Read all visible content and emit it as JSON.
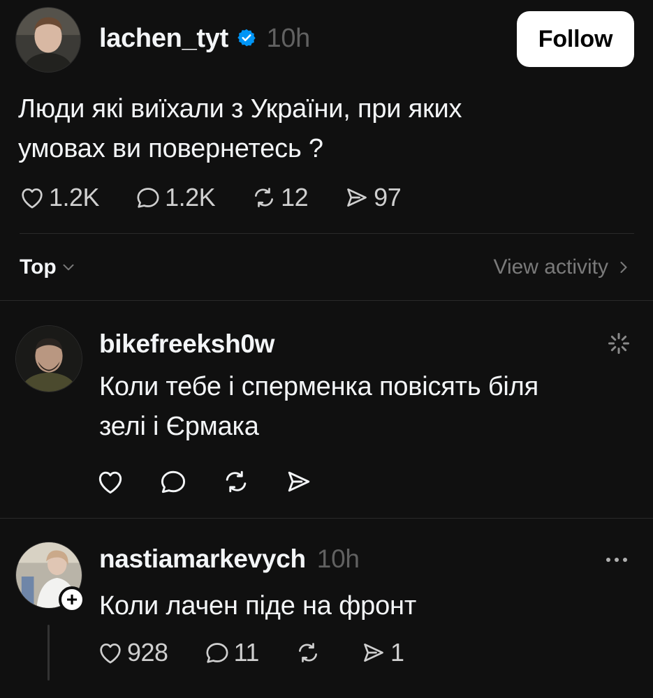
{
  "post": {
    "username": "lachen_tyt",
    "time": "10h",
    "follow_label": "Follow",
    "text_line1": "Люди які виїхали з України, при яких",
    "text_line2": "умовах ви повернетесь ?",
    "likes": "1.2K",
    "comments": "1.2K",
    "reposts": "12",
    "shares": "97"
  },
  "sort": {
    "label": "Top",
    "view_activity": "View activity"
  },
  "replies": [
    {
      "username": "bikefreeksh0w",
      "text_line1": "Коли тебе і сперменка повісять біля",
      "text_line2": "зелі і Єрмака"
    },
    {
      "username": "nastiamarkevych",
      "time": "10h",
      "text": "Коли лачен піде на фронт",
      "likes": "928",
      "comments": "11",
      "reposts": "",
      "shares": "1"
    }
  ],
  "colors": {
    "background": "#101010",
    "verified": "#0095f6",
    "muted": "#616161"
  }
}
